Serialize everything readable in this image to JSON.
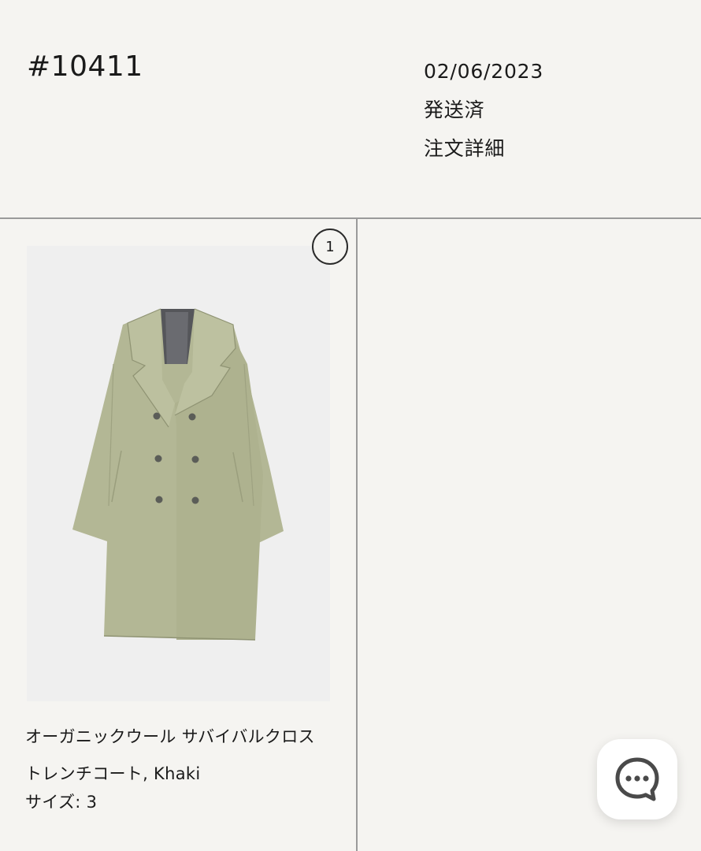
{
  "order": {
    "number": "#10411",
    "date": "02/06/2023",
    "status": "発送済",
    "details_label": "注文詳細"
  },
  "product": {
    "quantity": "1",
    "name": "オーガニックウール サバイバルクロス トレンチコート, Khaki",
    "size_label": "サイズ: 3",
    "image_icon": "khaki-trench-coat-image"
  },
  "chat": {
    "icon": "chat-bubble-icon"
  },
  "colors": {
    "background": "#f5f4f1",
    "divider": "#9a9a9a",
    "coat": "#b3b795",
    "image_bg": "#efefef"
  }
}
